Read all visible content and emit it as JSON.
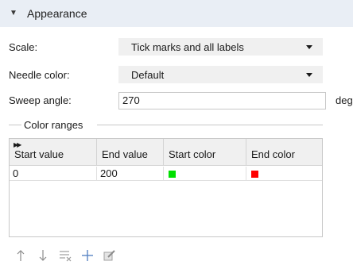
{
  "section": {
    "title": "Appearance",
    "icon": "chevron-down-icon"
  },
  "scale": {
    "label": "Scale:",
    "value": "Tick marks and all labels"
  },
  "needle_color": {
    "label": "Needle color:",
    "value": "Default"
  },
  "sweep_angle": {
    "label": "Sweep angle:",
    "value": "270",
    "unit": "deg"
  },
  "color_ranges": {
    "title": "Color ranges",
    "columns": [
      "Start value",
      "End value",
      "Start color",
      "End color"
    ],
    "rows": [
      {
        "start_value": "0",
        "end_value": "200",
        "start_color": "#00e000",
        "end_color": "#ff0000"
      }
    ]
  },
  "toolbar": {
    "icons": [
      "move-up-icon",
      "move-down-icon",
      "clear-table-icon",
      "add-icon",
      "edit-icon"
    ]
  }
}
